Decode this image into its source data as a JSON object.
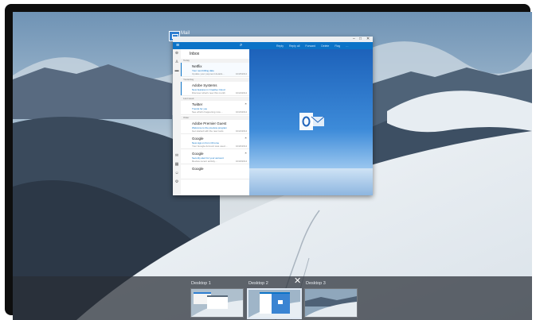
{
  "mail": {
    "app_title": "Mail",
    "titlebar_text": "",
    "window_controls": [
      "–",
      "□",
      "✕"
    ],
    "command_bar": {
      "actions": [
        "Reply",
        "Reply all",
        "Forward",
        "Delete",
        "Flag",
        "…"
      ]
    },
    "folder": "Inbox",
    "groups": [
      "Today",
      "Yesterday",
      "Last week",
      "Older"
    ],
    "messages": [
      {
        "sender": "Netflix",
        "subject": "Your next billing date",
        "preview": "Update your payment details…",
        "date": "10/25/2014"
      },
      {
        "sender": "Adobe Systems",
        "subject": "New features in Creative Cloud",
        "preview": "Discover what's new this month",
        "date": "10/24/2014"
      },
      {
        "sender": "Twitter",
        "subject": "Trends for you",
        "preview": "See what's happening now…",
        "date": "10/23/2014"
      },
      {
        "sender": "Adobe Premier Guest",
        "subject": "Welcome to the preview program",
        "preview": "Get started with the new tools",
        "date": "10/22/2014"
      },
      {
        "sender": "Google",
        "subject": "New sign-in from Chrome",
        "preview": "Your Google Account was used…",
        "date": "10/20/2014"
      },
      {
        "sender": "Google",
        "subject": "Security alert for your account",
        "preview": "Review recent activity…",
        "date": "10/18/2014"
      },
      {
        "sender": "Google",
        "subject": "",
        "preview": "",
        "date": ""
      }
    ]
  },
  "taskview": {
    "desktops": [
      {
        "label": "Desktop 1"
      },
      {
        "label": "Desktop 2"
      },
      {
        "label": "Desktop 3"
      }
    ],
    "close_glyph": "✕"
  },
  "colors": {
    "accent": "#0b73c7",
    "sky_top": "#5b89b5",
    "snow": "#e9eef3"
  },
  "icons": [
    "search-icon",
    "hamburger-icon",
    "outlook-icon",
    "close-icon",
    "mail-app-icon"
  ]
}
